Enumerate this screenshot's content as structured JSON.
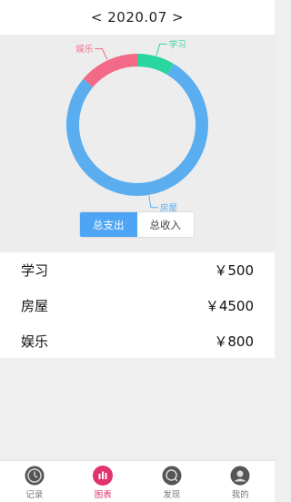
{
  "header": {
    "month_label": "< 2020.07 >"
  },
  "chart_data": {
    "type": "pie",
    "series": [
      {
        "name": "学习",
        "value": 500,
        "color": "#2ad6a0"
      },
      {
        "name": "房屋",
        "value": 4500,
        "color": "#5aaef0"
      },
      {
        "name": "娱乐",
        "value": 800,
        "color": "#f26a86"
      }
    ]
  },
  "toggle": {
    "expense_label": "总支出",
    "income_label": "总收入"
  },
  "list": [
    {
      "name": "学习",
      "amount": "￥500"
    },
    {
      "name": "房屋",
      "amount": "￥4500"
    },
    {
      "name": "娱乐",
      "amount": "￥800"
    }
  ],
  "tabs": [
    {
      "label": "记录",
      "icon": "clock-icon"
    },
    {
      "label": "图表",
      "icon": "chart-icon"
    },
    {
      "label": "发现",
      "icon": "discover-icon"
    },
    {
      "label": "我的",
      "icon": "user-icon"
    }
  ],
  "colors": {
    "accent_pink": "#e0336e",
    "toggle_blue": "#4ea5f5"
  }
}
